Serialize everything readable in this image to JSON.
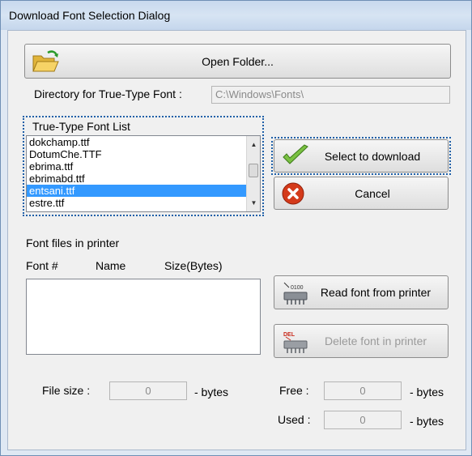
{
  "window": {
    "title": "Download Font Selection Dialog"
  },
  "open_folder": {
    "label": "Open Folder..."
  },
  "directory": {
    "label": "Directory for True-Type Font :",
    "value": "C:\\Windows\\Fonts\\"
  },
  "font_list": {
    "label": "True-Type Font List",
    "items": [
      "dokchamp.ttf",
      "DotumChe.TTF",
      "ebrima.ttf",
      "ebrimabd.ttf",
      "entsani.ttf",
      "estre.ttf"
    ],
    "selected": "entsani.ttf"
  },
  "buttons": {
    "select": "Select to download",
    "cancel": "Cancel",
    "read_font": "Read font from printer",
    "delete_font": "Delete font in printer"
  },
  "printer_fonts": {
    "label": "Font files in printer",
    "columns": [
      "Font #",
      "Name",
      "Size(Bytes)"
    ]
  },
  "file_size": {
    "label": "File size :",
    "value": "0",
    "unit": "- bytes"
  },
  "free": {
    "label": "Free :",
    "value": "0",
    "unit": "- bytes"
  },
  "used": {
    "label": "Used :",
    "value": "0",
    "unit": "- bytes"
  },
  "colors": {
    "selection": "#3399ff",
    "focus": "#1e5fa8",
    "titlebar": "#c9d9ec"
  }
}
